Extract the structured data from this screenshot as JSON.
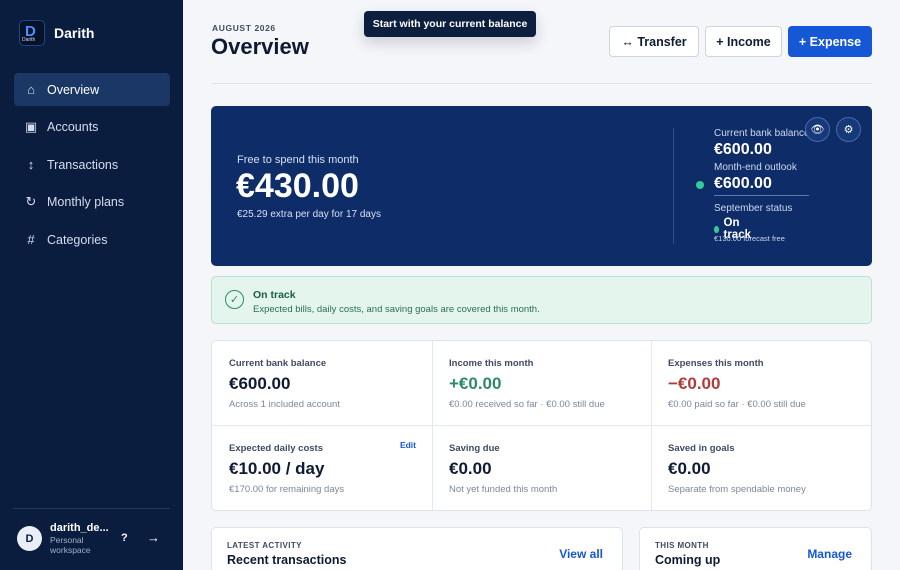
{
  "app": {
    "name": "Darith",
    "logo_letter": "D",
    "logo_text": "Darith"
  },
  "sidebar": {
    "items": [
      {
        "label": "Overview",
        "icon": "home-icon",
        "glyph": "⌂",
        "active": true
      },
      {
        "label": "Accounts",
        "icon": "wallet-icon",
        "glyph": "▣",
        "active": false
      },
      {
        "label": "Transactions",
        "icon": "arrows-vertical-icon",
        "glyph": "↕",
        "active": false
      },
      {
        "label": "Monthly plans",
        "icon": "refresh-icon",
        "glyph": "↻",
        "active": false
      },
      {
        "label": "Categories",
        "icon": "hash-icon",
        "glyph": "#",
        "active": false
      }
    ],
    "user": {
      "initial": "D",
      "name": "darith_de...",
      "workspace": "Personal workspace"
    },
    "help_label": "?",
    "logout_label": "→"
  },
  "header": {
    "eyebrow": "AUGUST 2026",
    "title": "Overview",
    "tooltip": "Start with your current balance",
    "transfer_label": "↔ Transfer",
    "income_label": "+ Income",
    "expense_label": "+ Expense"
  },
  "hero": {
    "label": "Free to spend this month",
    "amount": "€430.00",
    "sub": "€25.29 extra per day for 17 days",
    "current_balance_label": "Current bank balance",
    "current_balance_value": "€600.00",
    "outlook_label": "Month-end outlook",
    "outlook_value": "€600.00",
    "next_status_label": "September status",
    "next_status_value": "On track",
    "forecast_text": "€130.00 forecast free",
    "eye_glyph": "👁",
    "gear_glyph": "⚙"
  },
  "banner": {
    "title": "On track",
    "text": "Expected bills, daily costs, and saving goals are covered this month.",
    "check_glyph": "✓"
  },
  "stats": [
    {
      "label": "Current bank balance",
      "value": "€600.00",
      "sub": "Across 1 included account",
      "tone": "default"
    },
    {
      "label": "Income this month",
      "value": "+€0.00",
      "sub": "€0.00 received so far · €0.00 still due",
      "tone": "green"
    },
    {
      "label": "Expenses this month",
      "value": "−€0.00",
      "sub": "€0.00 paid so far · €0.00 still due",
      "tone": "red"
    },
    {
      "label": "Expected daily costs",
      "value": "€10.00 / day",
      "sub": "€170.00 for remaining days",
      "tone": "default",
      "edit_label": "Edit"
    },
    {
      "label": "Saving due",
      "value": "€0.00",
      "sub": "Not yet funded this month",
      "tone": "default"
    },
    {
      "label": "Saved in goals",
      "value": "€0.00",
      "sub": "Separate from spendable money",
      "tone": "default"
    }
  ],
  "activity": {
    "eyebrow": "LATEST ACTIVITY",
    "title": "Recent transactions",
    "link": "View all"
  },
  "coming": {
    "eyebrow": "THIS MONTH",
    "title": "Coming up",
    "link": "Manage"
  },
  "colors": {
    "sidebar_bg": "#0b1d3f",
    "hero_bg": "#0d2c68",
    "accent": "#1657d6",
    "positive": "#2d8a64",
    "negative": "#b23a3a"
  }
}
